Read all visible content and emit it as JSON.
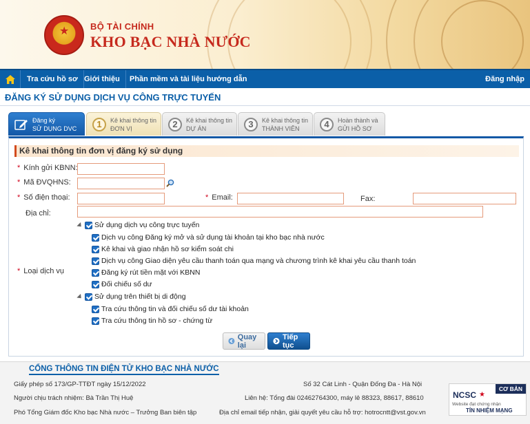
{
  "header": {
    "ministry": "BỘ TÀI CHÍNH",
    "agency": "KHO BẠC NHÀ NƯỚC"
  },
  "nav": {
    "items": [
      "Tra cứu hồ sơ",
      "Giới thiệu",
      "Phần mềm và tài liệu hướng dẫn"
    ],
    "login": "Đăng nhập"
  },
  "page": {
    "title": "ĐĂNG KÝ SỬ DỤNG DỊCH VỤ CÔNG TRỰC TUYẾN"
  },
  "steps": [
    {
      "num": "",
      "line1": "Đăng ký",
      "line2": "SỬ DỤNG DVC"
    },
    {
      "num": "1",
      "line1": "Kê khai thông tin",
      "line2": "ĐƠN VỊ"
    },
    {
      "num": "2",
      "line1": "Kê khai thông tin",
      "line2": "DỰ ÁN"
    },
    {
      "num": "3",
      "line1": "Kê khai thông tin",
      "line2": "THÀNH VIÊN"
    },
    {
      "num": "4",
      "line1": "Hoàn thành và",
      "line2": "GỬI HỒ SƠ"
    }
  ],
  "form": {
    "section_title": "Kê khai thông tin đơn vị đăng ký sử dụng",
    "labels": {
      "kbnn": "Kính gửi KBNN:",
      "dvqhns": "Mã ĐVQHNS:",
      "phone": "Số điện thoại:",
      "email": "Email:",
      "fax": "Fax:",
      "address": "Địa chỉ:",
      "service_type": "Loại dịch vụ"
    },
    "values": {
      "kbnn": "",
      "dvqhns": "",
      "phone": "",
      "email": "",
      "fax": "",
      "address": ""
    },
    "required_mark": "*",
    "services": {
      "online": {
        "label": "Sử dụng dịch vụ công trực tuyến",
        "items": [
          "Dịch vụ công Đăng ký mở và sử dụng tài khoản tại kho bạc nhà nước",
          "Kê khai và giao nhận hồ sơ kiểm soát chi",
          "Dịch vụ công Giao diện yêu cầu thanh toán qua mạng và chương trình kê khai yêu cầu thanh toán",
          "Đăng ký rút tiền mặt với KBNN",
          "Đối chiếu số dư"
        ]
      },
      "mobile": {
        "label": "Sử dụng trên thiết bị di động",
        "items": [
          "Tra cứu thông tin và đối chiếu số dư tài khoản",
          "Tra cứu thông tin hồ sơ - chứng từ"
        ]
      }
    },
    "buttons": {
      "back": "Quay lại",
      "next": "Tiếp tục"
    }
  },
  "footer": {
    "title": "CỔNG THÔNG TIN ĐIỆN TỬ KHO BẠC NHÀ NƯỚC",
    "license": "Giấy phép số 173/GP-TTĐT ngày 15/12/2022",
    "responsible": "Người chịu trách nhiệm: Bà Trần Thị Huệ",
    "deputy": "Phó Tổng Giám đốc Kho bạc Nhà nước – Trưởng Ban biên tập",
    "address": "Số 32 Cát Linh - Quận Đống Đa - Hà Nội",
    "contact": "Liên hệ: Tổng đài 02462764300, máy lẻ 88323, 88617, 88610",
    "email": "Địa chỉ email tiếp nhận, giải quyết yêu cầu hỗ trợ: hotrocntt@vst.gov.vn",
    "badge": {
      "org": "NCSC",
      "tier": "CƠ BẢN",
      "line1": "Website đạt chứng nhận",
      "line2": "TÍN NHIỆM MẠNG"
    }
  }
}
